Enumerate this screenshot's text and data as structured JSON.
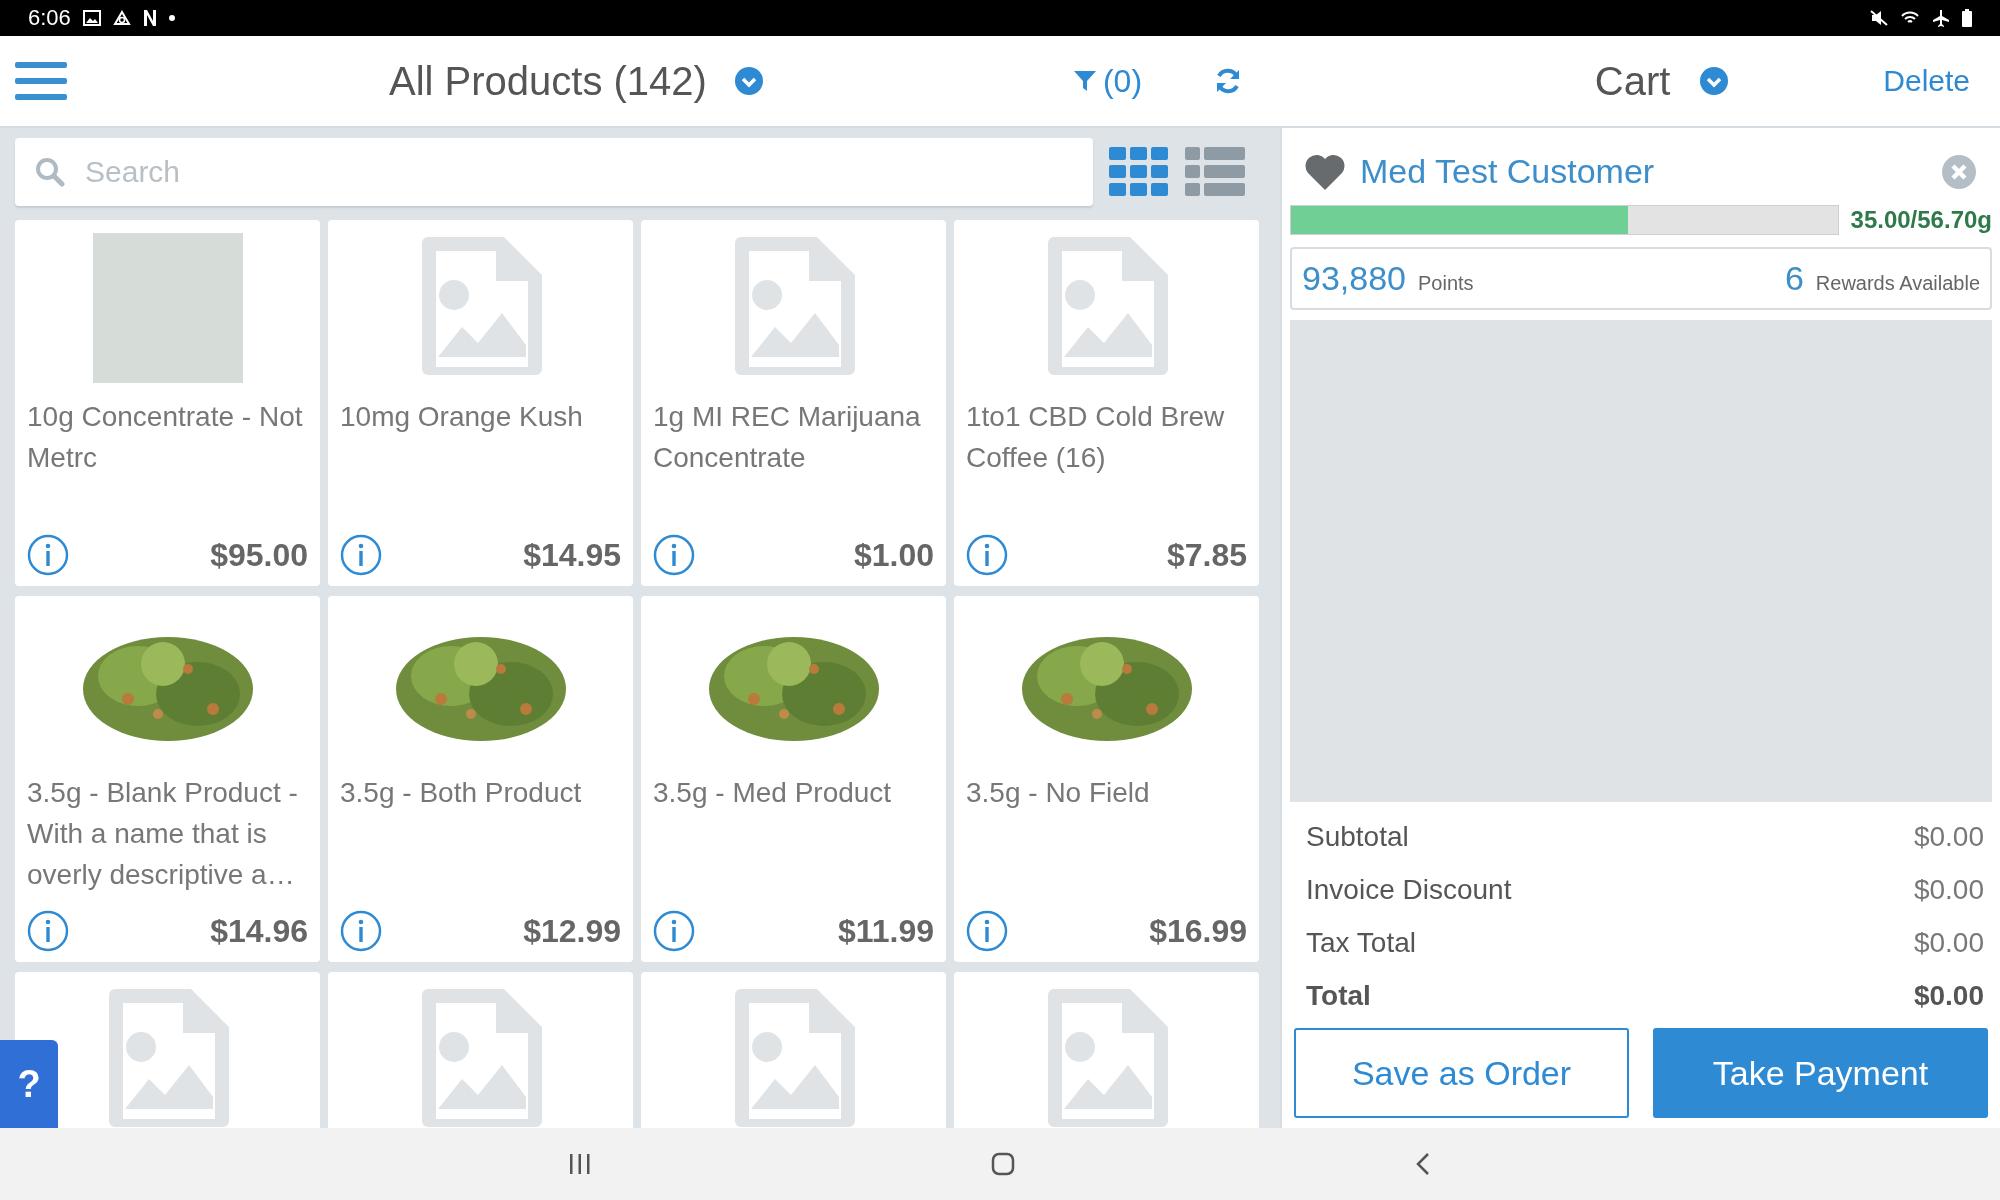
{
  "status_bar": {
    "time": "6:06"
  },
  "header": {
    "title": "All Products (142)",
    "filter": "(0)",
    "cart_title": "Cart",
    "delete": "Delete"
  },
  "search": {
    "placeholder": "Search"
  },
  "view_toggle": [
    {
      "kind": "grid",
      "selected": true
    },
    {
      "kind": "list",
      "selected": false
    }
  ],
  "products": [
    {
      "kind": "photo",
      "name": "10g Concentrate - Not Metrc",
      "price": "$95.00"
    },
    {
      "kind": "placeholder",
      "name": "10mg Orange Kush",
      "price": "$14.95"
    },
    {
      "kind": "placeholder",
      "name": "1g MI REC Marijuana Concentrate",
      "price": "$1.00"
    },
    {
      "kind": "placeholder",
      "name": "1to1 CBD Cold Brew Coffee (16)",
      "price": "$7.85"
    },
    {
      "kind": "flower",
      "name": "3.5g - Blank Product - With a name that is overly descriptive a…",
      "price": "$14.96"
    },
    {
      "kind": "flower",
      "name": "3.5g - Both Product",
      "price": "$12.99"
    },
    {
      "kind": "flower",
      "name": "3.5g - Med Product",
      "price": "$11.99"
    },
    {
      "kind": "flower",
      "name": "3.5g - No Field",
      "price": "$16.99"
    },
    {
      "kind": "placeholder"
    },
    {
      "kind": "placeholder"
    },
    {
      "kind": "placeholder"
    },
    {
      "kind": "placeholder"
    }
  ],
  "help": "?",
  "customer": {
    "name": "Med Test Customer",
    "level": 0.617,
    "limit": "35.00/56.70g",
    "points": "93,880",
    "points_label": "Points",
    "rewards": "6",
    "rewards_label": "Rewards Available"
  },
  "totals": [
    {
      "label": "Subtotal",
      "value": "$0.00",
      "bold": false
    },
    {
      "label": "Invoice Discount",
      "value": "$0.00",
      "bold": false
    },
    {
      "label": "Tax Total",
      "value": "$0.00",
      "bold": false
    },
    {
      "label": "Total",
      "value": "$0.00",
      "bold": true
    }
  ],
  "buttons": {
    "save": "Save as Order",
    "pay": "Take Payment"
  }
}
